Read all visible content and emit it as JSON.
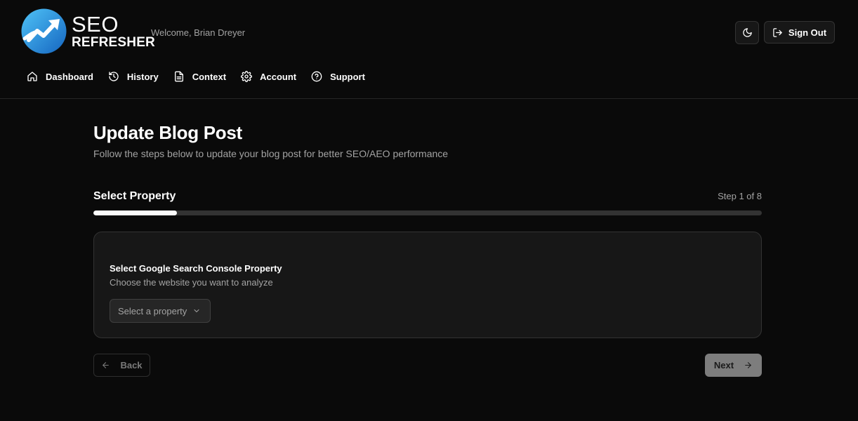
{
  "header": {
    "logo_line1": "SEO",
    "logo_line2": "REFRESHER",
    "welcome": "Welcome, Brian Dreyer",
    "signout_label": "Sign Out"
  },
  "nav": {
    "items": [
      {
        "label": "Dashboard",
        "icon": "home-icon"
      },
      {
        "label": "History",
        "icon": "history-icon"
      },
      {
        "label": "Context",
        "icon": "document-icon"
      },
      {
        "label": "Account",
        "icon": "gear-icon"
      },
      {
        "label": "Support",
        "icon": "help-circle-icon"
      }
    ]
  },
  "page": {
    "title": "Update Blog Post",
    "subtitle": "Follow the steps below to update your blog post for better SEO/AEO performance"
  },
  "steps": {
    "current_title": "Select Property",
    "counter": "Step 1 of 8",
    "progress_fraction": 0.125
  },
  "card": {
    "title": "Select Google Search Console Property",
    "description": "Choose the website you want to analyze",
    "select_placeholder": "Select a property"
  },
  "actions": {
    "back_label": "Back",
    "next_label": "Next"
  },
  "colors": {
    "background": "#0a0a0a",
    "card": "#171717",
    "logo_blue": "#1e88e5",
    "progress_fill": "#fafafa"
  }
}
